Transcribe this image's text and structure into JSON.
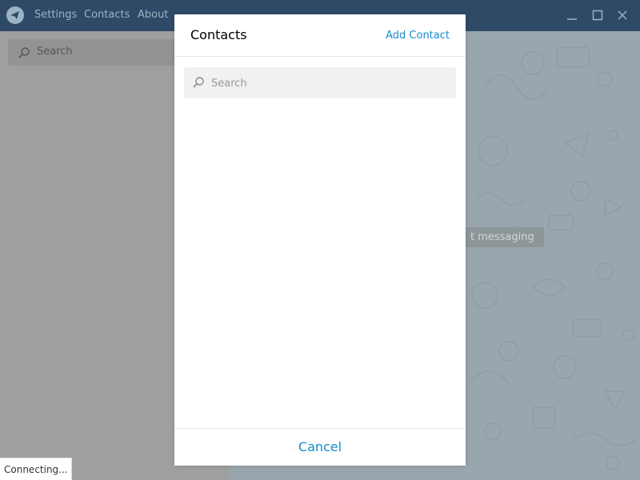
{
  "titlebar": {
    "menu": [
      {
        "label": "Settings"
      },
      {
        "label": "Contacts"
      },
      {
        "label": "About"
      }
    ],
    "logo_icon": "telegram-plane-icon",
    "window_buttons": [
      "minimize-icon",
      "maximize-icon",
      "close-icon"
    ]
  },
  "left": {
    "search_placeholder": "Search"
  },
  "chat": {
    "start_messaging": "t messaging"
  },
  "status": {
    "text": "Connecting..."
  },
  "modal": {
    "title": "Contacts",
    "add_contact": "Add Contact",
    "search_placeholder": "Search",
    "cancel": "Cancel"
  },
  "colors": {
    "accent": "#168acd",
    "titlebar": "#2f4a66"
  }
}
